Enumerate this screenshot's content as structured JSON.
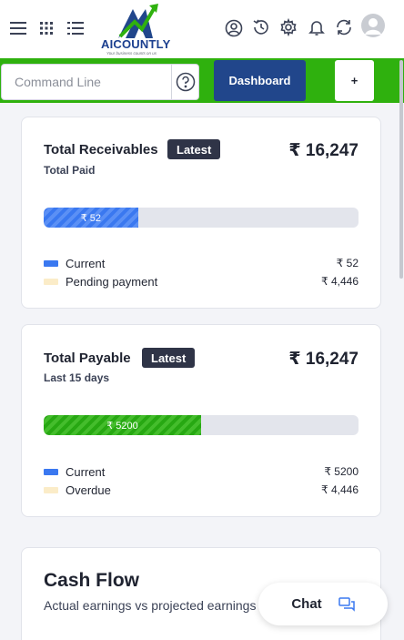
{
  "header": {
    "brand": "AICOUNTLY",
    "tagline": "Your business counts on us",
    "icons": [
      "menu-icon",
      "apps-grid-icon",
      "list-icon",
      "profile-icon",
      "history-icon",
      "settings-gear-icon",
      "bell-icon",
      "sync-icon",
      "user-avatar-icon"
    ]
  },
  "command_bar": {
    "placeholder": "Command Line",
    "help_icon": "help-circle-icon",
    "dashboard_label": "Dashboard",
    "plus_label": "+"
  },
  "receivables": {
    "title": "Total Receivables",
    "badge": "Latest",
    "amount": "₹ 16,247",
    "subtitle": "Total Paid",
    "bar_label": "₹ 52",
    "bar_fraction": 0.3,
    "legend": [
      {
        "label": "Current",
        "value": "₹ 52",
        "color": "#3a78f0"
      },
      {
        "label": "Pending payment",
        "value": "₹ 4,446",
        "color": "#fbecc8"
      }
    ]
  },
  "payable": {
    "title": "Total Payable",
    "badge": "Latest",
    "amount": "₹ 16,247",
    "subtitle": "Last 15 days",
    "bar_label": "₹ 5200",
    "bar_fraction": 0.5,
    "legend": [
      {
        "label": "Current",
        "value": "₹ 5200",
        "color": "#3a78f0"
      },
      {
        "label": "Overdue",
        "value": "₹ 4,446",
        "color": "#fbecc8"
      }
    ]
  },
  "cash_flow": {
    "title": "Cash Flow",
    "subtitle": "Actual earnings vs projected earnings"
  },
  "chat": {
    "label": "Chat",
    "icon": "chat-bubble-icon"
  },
  "colors": {
    "accent_green": "#2fb10e",
    "brand_blue": "#21468b",
    "badge_dark": "#2f3447"
  }
}
